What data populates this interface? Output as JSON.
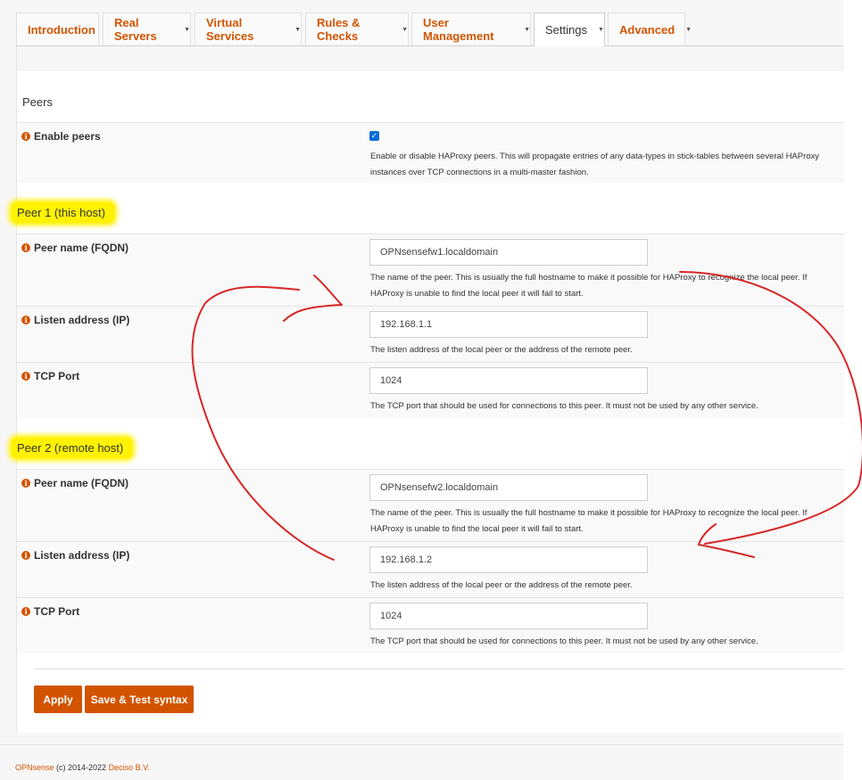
{
  "tabs": [
    {
      "label": "Introduction",
      "dropdown": false
    },
    {
      "label": "Real Servers",
      "dropdown": true
    },
    {
      "label": "Virtual Services",
      "dropdown": true
    },
    {
      "label": "Rules & Checks",
      "dropdown": true
    },
    {
      "label": "User Management",
      "dropdown": true
    },
    {
      "label": "Settings",
      "dropdown": true,
      "active": true
    },
    {
      "label": "Advanced",
      "dropdown": true
    }
  ],
  "peers_section": {
    "title": "Peers",
    "enable_label": "Enable peers",
    "enable_checked": true,
    "enable_help": "Enable or disable HAProxy peers. This will propagate entries of any data-types in stick-tables between several HAProxy instances over TCP connections in a multi-master fashion."
  },
  "peer1": {
    "title": "Peer 1 (this host)",
    "name_label": "Peer name (FQDN)",
    "name_value": "OPNsensefw1.localdomain",
    "name_help": "The name of the peer. This is usually the full hostname to make it possible for HAProxy to recognize the local peer. If HAProxy is unable to find the local peer it will fail to start.",
    "address_label": "Listen address (IP)",
    "address_value": "192.168.1.1",
    "address_help": "The listen address of the local peer or the address of the remote peer.",
    "port_label": "TCP Port",
    "port_value": "1024",
    "port_help": "The TCP port that should be used for connections to this peer. It must not be used by any other service."
  },
  "peer2": {
    "title": "Peer 2 (remote host)",
    "name_label": "Peer name (FQDN)",
    "name_value": "OPNsensefw2.localdomain",
    "name_help": "The name of the peer. This is usually the full hostname to make it possible for HAProxy to recognize the local peer. If HAProxy is unable to find the local peer it will fail to start.",
    "address_label": "Listen address (IP)",
    "address_value": "192.168.1.2",
    "address_help": "The listen address of the local peer or the address of the remote peer.",
    "port_label": "TCP Port",
    "port_value": "1024",
    "port_help": "The TCP port that should be used for connections to this peer. It must not be used by any other service."
  },
  "buttons": {
    "apply": "Apply",
    "save_test": "Save & Test syntax"
  },
  "footer": {
    "brand": "OPNsense",
    "copyright": " (c) 2014-2022 ",
    "company": "Deciso B.V."
  },
  "colors": {
    "accent": "#d35400",
    "highlight": "#fff200",
    "annotation": "#d62828",
    "checkbox": "#0a6cd6"
  }
}
